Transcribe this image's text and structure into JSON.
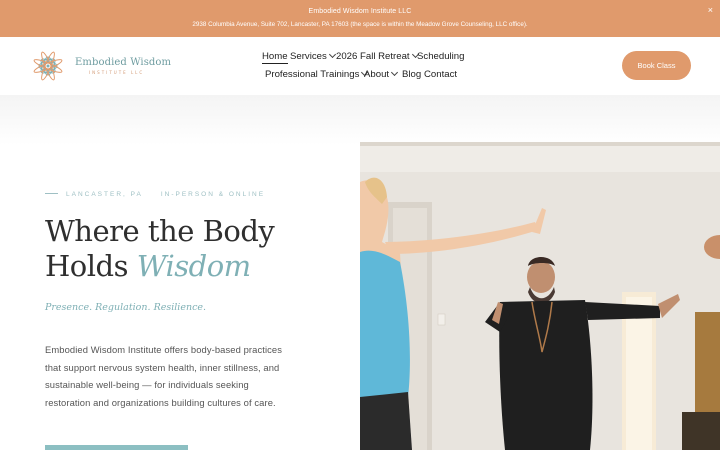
{
  "announcement": {
    "title": "Embodied Wisdom Institute LLC",
    "address": "2938 Columbia Avenue, Suite 702, Lancaster, PA 17603 (the space is within the Meadow Grove Counseling, LLC office).",
    "close": "×"
  },
  "logo": {
    "name": "Embodied Wisdom",
    "sub": "INSTITUTE LLC"
  },
  "nav": {
    "home": "Home",
    "services": "Services",
    "retreat": "2026 Fall Retreat",
    "scheduling": "Scheduling",
    "trainings": "Professional Trainings",
    "about": "About",
    "blog": "Blog",
    "contact": "Contact"
  },
  "book_button": "Book Class",
  "hero": {
    "location": "LANCASTER, PA",
    "mode": "IN-PERSON & ONLINE",
    "title_line1": "Where the Body",
    "title_line2_plain": "Holds ",
    "title_line2_accent": "Wisdom",
    "tagline": "Presence. Regulation. Resilience.",
    "description": "Embodied Wisdom Institute offers body-based practices that support nervous system health, inner stillness, and sustainable well-being — for individuals seeking restoration and organizations building cultures of care."
  },
  "colors": {
    "accent_orange": "#e09a6c",
    "accent_teal": "#7fb0b5",
    "text_dark": "#2f2f2f"
  }
}
